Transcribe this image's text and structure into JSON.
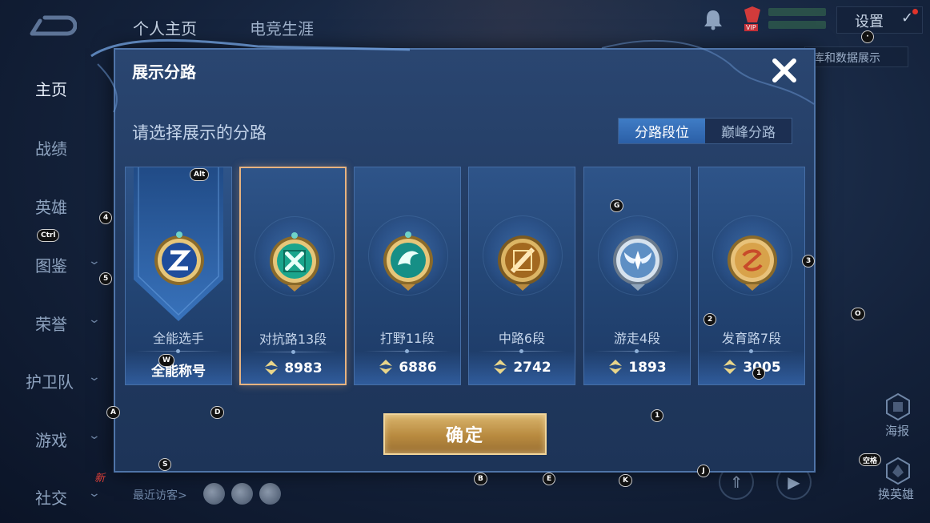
{
  "topbar": {
    "tabs": [
      "个人主页",
      "电竞生涯"
    ],
    "settings_label": "设置",
    "side_button": "库和数据展示",
    "vip_label": "VIP"
  },
  "sidebar": {
    "items": [
      {
        "label": "主页",
        "active": true
      },
      {
        "label": "战绩"
      },
      {
        "label": "英雄"
      },
      {
        "label": "图鉴"
      },
      {
        "label": "荣誉"
      },
      {
        "label": "护卫队"
      },
      {
        "label": "游戏"
      },
      {
        "label": "社交"
      }
    ],
    "new_tag": "新",
    "recent_visitors": "最近访客>"
  },
  "right_panel": {
    "poster_label": "海报",
    "change_hero_label": "换英雄"
  },
  "modal": {
    "title": "展示分路",
    "subtitle": "请选择展示的分路",
    "segments": [
      {
        "label": "分路段位",
        "active": true
      },
      {
        "label": "巅峰分路",
        "active": false
      }
    ],
    "cards": [
      {
        "name": "全能选手",
        "score": "全能称号",
        "emblem": "allround",
        "selected": false
      },
      {
        "name": "对抗路13段",
        "score": "8983",
        "emblem": "clash",
        "selected": true
      },
      {
        "name": "打野11段",
        "score": "6886",
        "emblem": "jungle",
        "selected": false
      },
      {
        "name": "中路6段",
        "score": "2742",
        "emblem": "mid",
        "selected": false
      },
      {
        "name": "游走4段",
        "score": "1893",
        "emblem": "roam",
        "selected": false
      },
      {
        "name": "发育路7段",
        "score": "3005",
        "emblem": "farm",
        "selected": false
      }
    ],
    "confirm_label": "确定"
  },
  "key_hints": {
    "alt": "Alt",
    "ctrl": "Ctrl",
    "space": "空格",
    "k4": "4",
    "k5": "5",
    "k3": "3",
    "k2": "2",
    "k1a": "1",
    "k1b": "1",
    "g": "G",
    "o": "O",
    "w": "W",
    "a": "A",
    "d": "D",
    "s": "S",
    "b": "B",
    "e": "E",
    "k": "K",
    "j": "J",
    "dot": "·"
  },
  "colors": {
    "accent_blue": "#3f7cc6",
    "confirm_gold": "#c99c4f",
    "selected_border": "#e7b380"
  }
}
